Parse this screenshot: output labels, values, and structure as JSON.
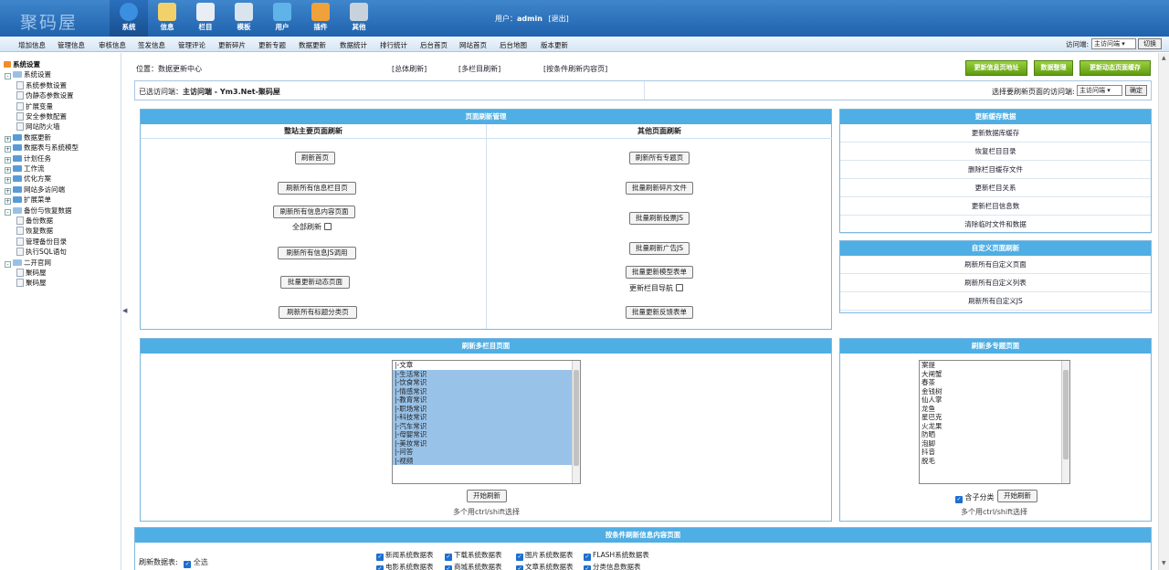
{
  "header": {
    "logo": "聚码屋",
    "user_label": "用户：",
    "username": "admin",
    "logout": "[退出]",
    "nav": [
      {
        "label": "系统",
        "icon": "globe-icon",
        "color": "#3b8fe0"
      },
      {
        "label": "信息",
        "icon": "pencil-note-icon",
        "color": "#f2d16b"
      },
      {
        "label": "栏目",
        "icon": "folder-icon",
        "color": "#e9eef5"
      },
      {
        "label": "模板",
        "icon": "window-icon",
        "color": "#d9e4ef"
      },
      {
        "label": "用户",
        "icon": "user-icon",
        "color": "#5fb3e8"
      },
      {
        "label": "插件",
        "icon": "tools-icon",
        "color": "#f0a23a"
      },
      {
        "label": "其他",
        "icon": "gear-icon",
        "color": "#c8d2dc"
      }
    ]
  },
  "subnav": {
    "items": [
      "增加信息",
      "管理信息",
      "审核信息",
      "签发信息",
      "管理评论",
      "更新碎片",
      "更新专题",
      "数据更新",
      "数据统计",
      "排行统计",
      "后台首页",
      "网站首页",
      "后台地图",
      "版本更新"
    ],
    "visit_label": "访问端:",
    "visit_value": "主访问端",
    "switch": "切换"
  },
  "sidebar": {
    "nodes": [
      {
        "label": "系统设置",
        "type": "root",
        "indent": 0
      },
      {
        "label": "系统设置",
        "type": "open",
        "indent": 1
      },
      {
        "label": "系统参数设置",
        "type": "leaf",
        "indent": 2
      },
      {
        "label": "伪静态参数设置",
        "type": "leaf",
        "indent": 2
      },
      {
        "label": "扩展变量",
        "type": "leaf",
        "indent": 2
      },
      {
        "label": "安全参数配置",
        "type": "leaf",
        "indent": 2
      },
      {
        "label": "网站防火墙",
        "type": "leaf",
        "indent": 2
      },
      {
        "label": "数据更新",
        "type": "closed",
        "indent": 1
      },
      {
        "label": "数据表与系统模型",
        "type": "closed",
        "indent": 1
      },
      {
        "label": "计划任务",
        "type": "closed",
        "indent": 1
      },
      {
        "label": "工作流",
        "type": "closed",
        "indent": 1
      },
      {
        "label": "优化方案",
        "type": "closed",
        "indent": 1
      },
      {
        "label": "网站多访问端",
        "type": "closed",
        "indent": 1
      },
      {
        "label": "扩展菜单",
        "type": "closed",
        "indent": 1
      },
      {
        "label": "备份与恢复数据",
        "type": "open",
        "indent": 1
      },
      {
        "label": "备份数据",
        "type": "leaf",
        "indent": 2
      },
      {
        "label": "恢复数据",
        "type": "leaf",
        "indent": 2
      },
      {
        "label": "管理备份目录",
        "type": "leaf",
        "indent": 2
      },
      {
        "label": "执行SQL语句",
        "type": "leaf",
        "indent": 2
      },
      {
        "label": "二开官网",
        "type": "open",
        "indent": 1
      },
      {
        "label": "聚码屋",
        "type": "leaf",
        "indent": 2
      },
      {
        "label": "聚码屋",
        "type": "leaf",
        "indent": 2
      }
    ]
  },
  "top": {
    "position": "位置：",
    "crumb": "数据更新中心",
    "links": [
      "[总体刷新]",
      "[多栏目刷新]",
      "[按条件刷新内容页]"
    ],
    "buttons": [
      "更新信息页地址",
      "数据整理",
      "更新动态页面缓存"
    ],
    "selected_label": "已选访问端：",
    "selected_value": "主访问端 - Ym3.Net-聚码屋",
    "choose_label": "选择要刷新页面的访问端:",
    "choose_value": "主访问端",
    "confirm": "确定"
  },
  "page_refresh": {
    "title": "页面刷新管理",
    "left_title": "整站主要页面刷新",
    "right_title": "其他页面刷新",
    "left_buttons": [
      "刷新首页",
      "刷新所有信息栏目页",
      "刷新所有信息内容页面",
      "刷新所有信息JS调用",
      "批量更新动态页面",
      "刷新所有标题分类页"
    ],
    "all_refresh": "全部刷新",
    "right_buttons": [
      "刷新所有专题页",
      "批量刷新碎片文件",
      "批量刷新投票JS",
      "批量刷新广告JS",
      "批量更新模型表单",
      "批量更新反馈表单"
    ],
    "update_nav": "更新栏目导航"
  },
  "cache": {
    "title": "更新缓存数据",
    "items": [
      "更新数据库缓存",
      "恢复栏目目录",
      "删除栏目缓存文件",
      "更新栏目关系",
      "更新栏目信息数",
      "清除临时文件和数据"
    ]
  },
  "custom": {
    "title": "自定义页面刷新",
    "items": [
      "刷新所有自定义页面",
      "刷新所有自定义列表",
      "刷新所有自定义JS"
    ]
  },
  "multi_col": {
    "title": "刷新多栏目页面",
    "options": [
      "|-文章",
      "|-生活常识",
      "|-饮食常识",
      "|-情感常识",
      "|-教育常识",
      "|-职场常识",
      "|-科技常识",
      "|-汽车常识",
      "|-母婴常识",
      "|-美妆常识",
      "|-问答",
      "|-视频"
    ],
    "start": "开始刷新",
    "hint": "多个用ctrl/shift选择"
  },
  "multi_topic": {
    "title": "刷新多专题页面",
    "options": [
      "案提",
      "大闸蟹",
      "春茶",
      "金钱树",
      "仙人掌",
      "龙鱼",
      "星巴克",
      "火龙果",
      "防晒",
      "泡脚",
      "抖音",
      "脱毛"
    ],
    "include_sub": "含子分类",
    "start": "开始刷新",
    "hint": "多个用ctrl/shift选择"
  },
  "cond": {
    "title": "按条件刷新信息内容页面",
    "table_label": "刷新数据表:",
    "all": "全选",
    "tables": [
      "新闻系统数据表",
      "下载系统数据表",
      "图片系统数据表",
      "FLASH系统数据表",
      "电影系统数据表",
      "商城系统数据表",
      "文章系统数据表",
      "分类信息数据表"
    ]
  }
}
